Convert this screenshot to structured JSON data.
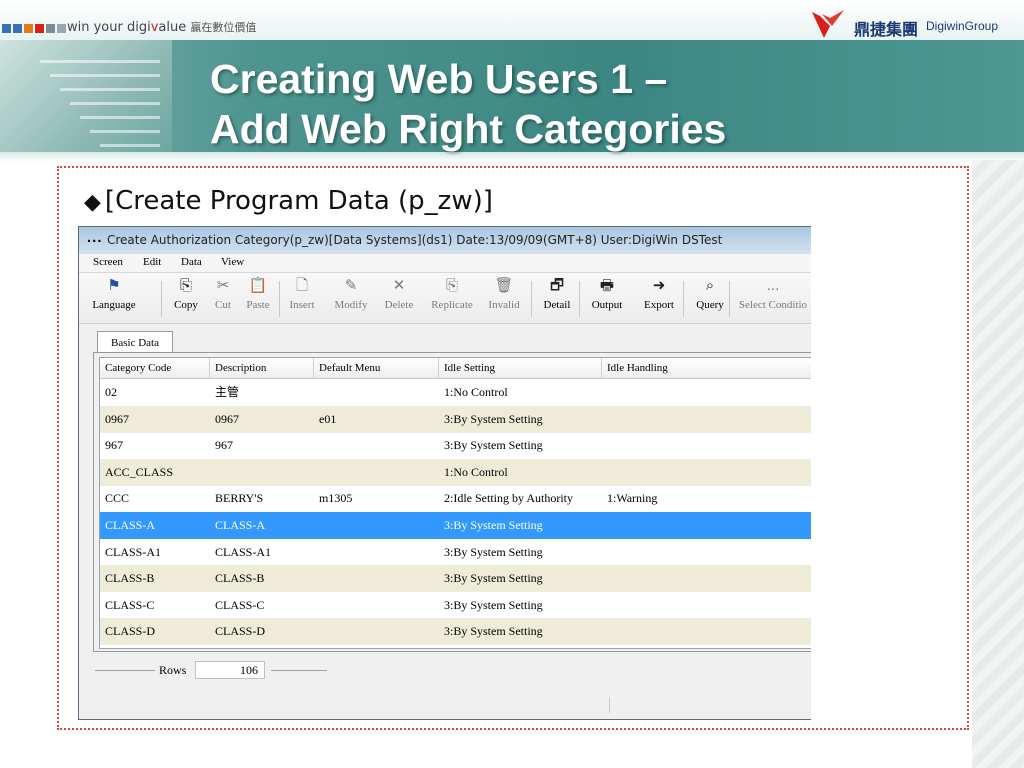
{
  "header": {
    "tagline_pre": "win your digi",
    "tagline_v": "v",
    "tagline_post": "alue",
    "tagline_cn": "贏在數位價值",
    "logo_cn": "鼎捷集團",
    "logo_en": "DigiwinGroup"
  },
  "slide": {
    "title_line1": "Creating Web Users 1 –",
    "title_line2": "Add Web Right Categories",
    "subtitle": "[Create Program Data (p_zw)]"
  },
  "window": {
    "dots": "...",
    "title": "Create Authorization Category(p_zw)[Data Systems](ds1)  Date:13/09/09(GMT+8)  User:DigiWin DSTest",
    "menu": [
      "Screen",
      "Edit",
      "Data",
      "View"
    ],
    "toolbar": [
      {
        "label": "Language",
        "icon": "flag-icon",
        "glyph": "⚑",
        "enabled": true
      },
      {
        "label": "Copy",
        "icon": "copy-icon",
        "glyph": "⎘",
        "enabled": true
      },
      {
        "label": "Cut",
        "icon": "scissors-icon",
        "glyph": "✂",
        "enabled": false
      },
      {
        "label": "Paste",
        "icon": "paste-icon",
        "glyph": "📋",
        "enabled": false
      },
      {
        "label": "Insert",
        "icon": "new-document-icon",
        "glyph": "🗋",
        "enabled": false
      },
      {
        "label": "Modify",
        "icon": "pencil-icon",
        "glyph": "✎",
        "enabled": false
      },
      {
        "label": "Delete",
        "icon": "delete-x-icon",
        "glyph": "✕",
        "enabled": false
      },
      {
        "label": "Replicate",
        "icon": "replicate-icon",
        "glyph": "⎘",
        "enabled": false
      },
      {
        "label": "Invalid",
        "icon": "trash-icon",
        "glyph": "🗑",
        "enabled": false
      },
      {
        "label": "Detail",
        "icon": "detail-icon",
        "glyph": "🗗",
        "enabled": true
      },
      {
        "label": "Output",
        "icon": "printer-icon",
        "glyph": "🖶",
        "enabled": true
      },
      {
        "label": "Export",
        "icon": "export-icon",
        "glyph": "➜",
        "enabled": true
      },
      {
        "label": "Query",
        "icon": "binoculars-icon",
        "glyph": "⌕",
        "enabled": true
      },
      {
        "label": "Select Conditio",
        "icon": "more-icon",
        "glyph": "...",
        "enabled": false
      }
    ],
    "tab": "Basic Data",
    "columns": [
      "Category Code",
      "Description",
      "Default Menu",
      "Idle Setting",
      "Idle Handling"
    ],
    "rows": [
      [
        "02",
        "主管",
        "",
        "1:No Control",
        ""
      ],
      [
        "0967",
        "0967",
        "e01",
        "3:By System Setting",
        ""
      ],
      [
        "967",
        "967",
        "",
        "3:By System Setting",
        ""
      ],
      [
        "ACC_CLASS",
        "",
        "",
        "1:No Control",
        ""
      ],
      [
        "CCC",
        "BERRY'S",
        "m1305",
        "2:Idle Setting by Authority",
        "1:Warning"
      ],
      [
        "CLASS-A",
        "CLASS-A",
        "",
        "3:By System Setting",
        ""
      ],
      [
        "CLASS-A1",
        "CLASS-A1",
        "",
        "3:By System Setting",
        ""
      ],
      [
        "CLASS-B",
        "CLASS-B",
        "",
        "3:By System Setting",
        ""
      ],
      [
        "CLASS-C",
        "CLASS-C",
        "",
        "3:By System Setting",
        ""
      ],
      [
        "CLASS-D",
        "CLASS-D",
        "",
        "3:By System Setting",
        ""
      ]
    ],
    "selected_row": 5,
    "rows_label": "Rows",
    "rows_count": "106"
  },
  "colors": {
    "accent_teal": "#3c8783",
    "selection_blue": "#3399ff",
    "alt_row": "#efebd9",
    "frame_red": "#d64541",
    "logo_red": "#d8201a"
  }
}
